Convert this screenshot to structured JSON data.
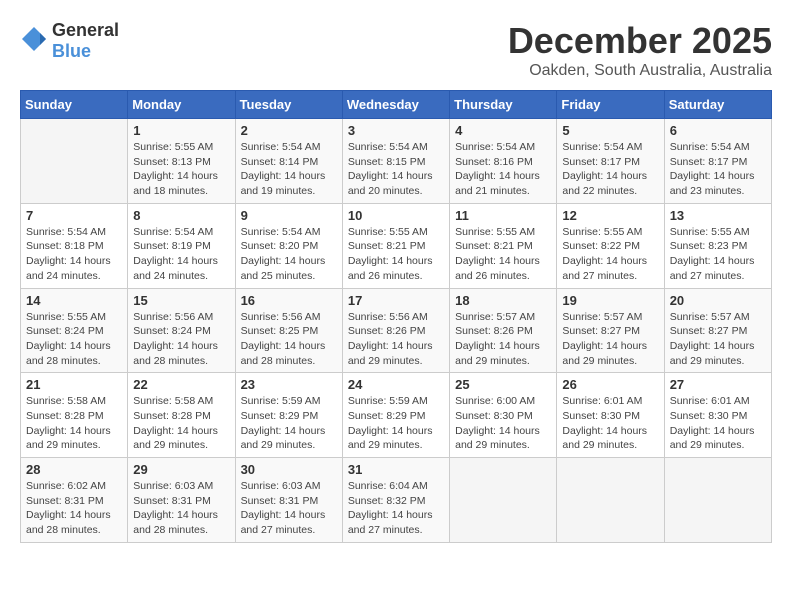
{
  "logo": {
    "general": "General",
    "blue": "Blue"
  },
  "header": {
    "title": "December 2025",
    "subtitle": "Oakden, South Australia, Australia"
  },
  "weekdays": [
    "Sunday",
    "Monday",
    "Tuesday",
    "Wednesday",
    "Thursday",
    "Friday",
    "Saturday"
  ],
  "weeks": [
    [
      {
        "day": "",
        "info": ""
      },
      {
        "day": "1",
        "info": "Sunrise: 5:55 AM\nSunset: 8:13 PM\nDaylight: 14 hours\nand 18 minutes."
      },
      {
        "day": "2",
        "info": "Sunrise: 5:54 AM\nSunset: 8:14 PM\nDaylight: 14 hours\nand 19 minutes."
      },
      {
        "day": "3",
        "info": "Sunrise: 5:54 AM\nSunset: 8:15 PM\nDaylight: 14 hours\nand 20 minutes."
      },
      {
        "day": "4",
        "info": "Sunrise: 5:54 AM\nSunset: 8:16 PM\nDaylight: 14 hours\nand 21 minutes."
      },
      {
        "day": "5",
        "info": "Sunrise: 5:54 AM\nSunset: 8:17 PM\nDaylight: 14 hours\nand 22 minutes."
      },
      {
        "day": "6",
        "info": "Sunrise: 5:54 AM\nSunset: 8:17 PM\nDaylight: 14 hours\nand 23 minutes."
      }
    ],
    [
      {
        "day": "7",
        "info": "Sunrise: 5:54 AM\nSunset: 8:18 PM\nDaylight: 14 hours\nand 24 minutes."
      },
      {
        "day": "8",
        "info": "Sunrise: 5:54 AM\nSunset: 8:19 PM\nDaylight: 14 hours\nand 24 minutes."
      },
      {
        "day": "9",
        "info": "Sunrise: 5:54 AM\nSunset: 8:20 PM\nDaylight: 14 hours\nand 25 minutes."
      },
      {
        "day": "10",
        "info": "Sunrise: 5:55 AM\nSunset: 8:21 PM\nDaylight: 14 hours\nand 26 minutes."
      },
      {
        "day": "11",
        "info": "Sunrise: 5:55 AM\nSunset: 8:21 PM\nDaylight: 14 hours\nand 26 minutes."
      },
      {
        "day": "12",
        "info": "Sunrise: 5:55 AM\nSunset: 8:22 PM\nDaylight: 14 hours\nand 27 minutes."
      },
      {
        "day": "13",
        "info": "Sunrise: 5:55 AM\nSunset: 8:23 PM\nDaylight: 14 hours\nand 27 minutes."
      }
    ],
    [
      {
        "day": "14",
        "info": "Sunrise: 5:55 AM\nSunset: 8:24 PM\nDaylight: 14 hours\nand 28 minutes."
      },
      {
        "day": "15",
        "info": "Sunrise: 5:56 AM\nSunset: 8:24 PM\nDaylight: 14 hours\nand 28 minutes."
      },
      {
        "day": "16",
        "info": "Sunrise: 5:56 AM\nSunset: 8:25 PM\nDaylight: 14 hours\nand 28 minutes."
      },
      {
        "day": "17",
        "info": "Sunrise: 5:56 AM\nSunset: 8:26 PM\nDaylight: 14 hours\nand 29 minutes."
      },
      {
        "day": "18",
        "info": "Sunrise: 5:57 AM\nSunset: 8:26 PM\nDaylight: 14 hours\nand 29 minutes."
      },
      {
        "day": "19",
        "info": "Sunrise: 5:57 AM\nSunset: 8:27 PM\nDaylight: 14 hours\nand 29 minutes."
      },
      {
        "day": "20",
        "info": "Sunrise: 5:57 AM\nSunset: 8:27 PM\nDaylight: 14 hours\nand 29 minutes."
      }
    ],
    [
      {
        "day": "21",
        "info": "Sunrise: 5:58 AM\nSunset: 8:28 PM\nDaylight: 14 hours\nand 29 minutes."
      },
      {
        "day": "22",
        "info": "Sunrise: 5:58 AM\nSunset: 8:28 PM\nDaylight: 14 hours\nand 29 minutes."
      },
      {
        "day": "23",
        "info": "Sunrise: 5:59 AM\nSunset: 8:29 PM\nDaylight: 14 hours\nand 29 minutes."
      },
      {
        "day": "24",
        "info": "Sunrise: 5:59 AM\nSunset: 8:29 PM\nDaylight: 14 hours\nand 29 minutes."
      },
      {
        "day": "25",
        "info": "Sunrise: 6:00 AM\nSunset: 8:30 PM\nDaylight: 14 hours\nand 29 minutes."
      },
      {
        "day": "26",
        "info": "Sunrise: 6:01 AM\nSunset: 8:30 PM\nDaylight: 14 hours\nand 29 minutes."
      },
      {
        "day": "27",
        "info": "Sunrise: 6:01 AM\nSunset: 8:30 PM\nDaylight: 14 hours\nand 29 minutes."
      }
    ],
    [
      {
        "day": "28",
        "info": "Sunrise: 6:02 AM\nSunset: 8:31 PM\nDaylight: 14 hours\nand 28 minutes."
      },
      {
        "day": "29",
        "info": "Sunrise: 6:03 AM\nSunset: 8:31 PM\nDaylight: 14 hours\nand 28 minutes."
      },
      {
        "day": "30",
        "info": "Sunrise: 6:03 AM\nSunset: 8:31 PM\nDaylight: 14 hours\nand 27 minutes."
      },
      {
        "day": "31",
        "info": "Sunrise: 6:04 AM\nSunset: 8:32 PM\nDaylight: 14 hours\nand 27 minutes."
      },
      {
        "day": "",
        "info": ""
      },
      {
        "day": "",
        "info": ""
      },
      {
        "day": "",
        "info": ""
      }
    ]
  ]
}
